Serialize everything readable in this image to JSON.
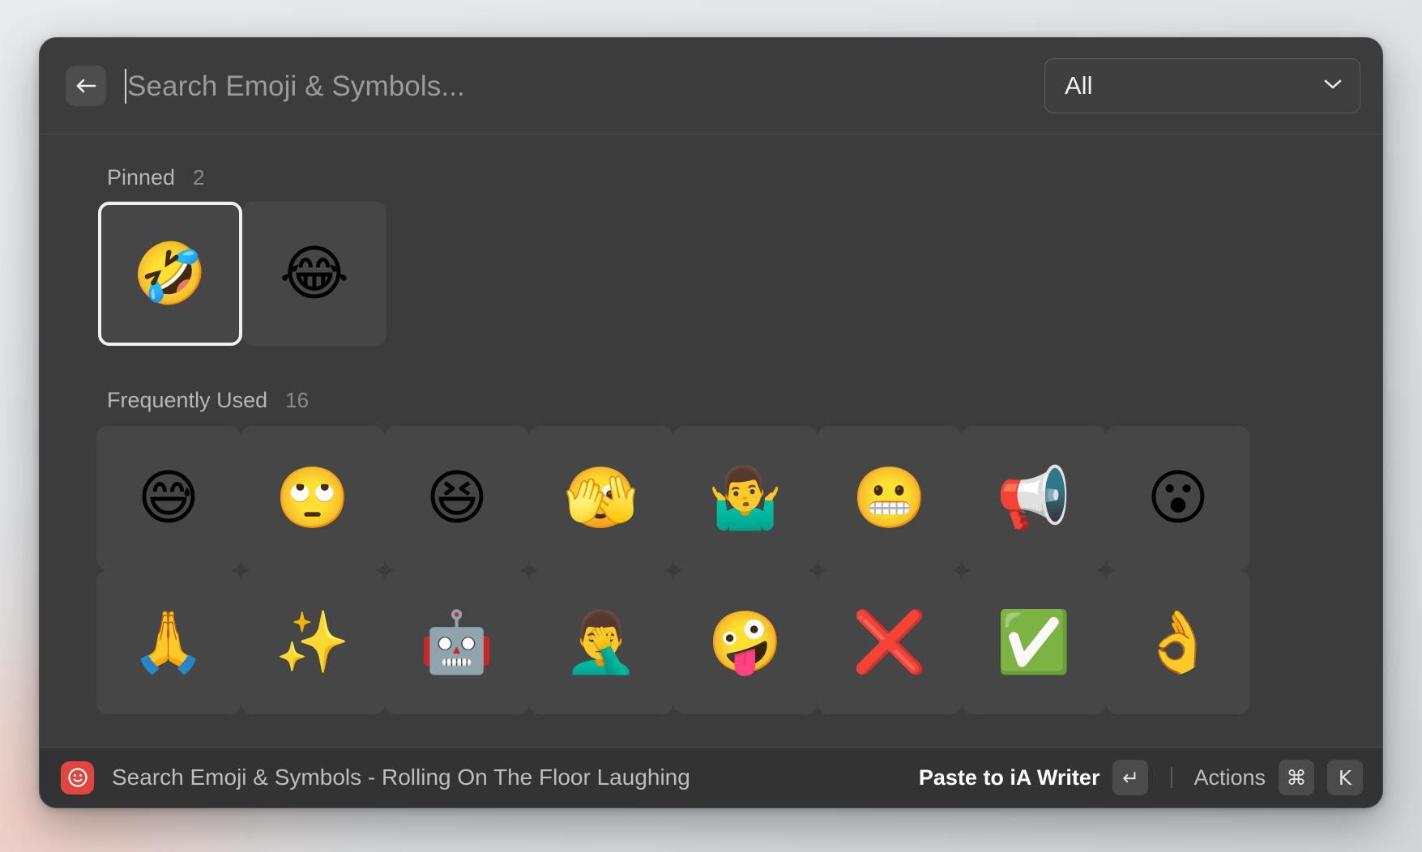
{
  "window": {
    "title_bar_visible": false
  },
  "search": {
    "placeholder": "Search Emoji & Symbols...",
    "value": "",
    "back_icon": "back-arrow-icon"
  },
  "category_filter": {
    "selected": "All",
    "chevron_icon": "chevron-down-icon"
  },
  "sections": [
    {
      "id": "pinned",
      "title": "Pinned",
      "count": "2",
      "items": [
        {
          "glyph": "🤣",
          "name": "rolling-on-the-floor-laughing",
          "selected": true
        },
        {
          "glyph": "😂",
          "name": "face-with-tears-of-joy",
          "selected": false
        }
      ]
    },
    {
      "id": "frequently-used",
      "title": "Frequently Used",
      "count": "16",
      "items": [
        {
          "glyph": "😅",
          "name": "grinning-face-with-sweat",
          "selected": false
        },
        {
          "glyph": "🙄",
          "name": "face-with-rolling-eyes",
          "selected": false
        },
        {
          "glyph": "😆",
          "name": "grinning-squinting-face",
          "selected": false
        },
        {
          "glyph": "🫣",
          "name": "face-with-peeking-eye",
          "selected": false
        },
        {
          "glyph": "🤷‍♂️",
          "name": "man-shrugging",
          "selected": false
        },
        {
          "glyph": "😬",
          "name": "grimacing-face",
          "selected": false
        },
        {
          "glyph": "📢",
          "name": "loudspeaker",
          "selected": false
        },
        {
          "glyph": "😮",
          "name": "face-with-open-mouth",
          "selected": false
        },
        {
          "glyph": "🙏",
          "name": "folded-hands",
          "selected": false
        },
        {
          "glyph": "✨",
          "name": "sparkles",
          "selected": false
        },
        {
          "glyph": "🤖",
          "name": "robot",
          "selected": false
        },
        {
          "glyph": "🤦‍♂️",
          "name": "man-facepalming",
          "selected": false
        },
        {
          "glyph": "🤪",
          "name": "zany-face",
          "selected": false
        },
        {
          "glyph": "❌",
          "name": "cross-mark",
          "selected": false
        },
        {
          "glyph": "✅",
          "name": "check-mark-button",
          "selected": false
        },
        {
          "glyph": "👌",
          "name": "ok-hand",
          "selected": false
        }
      ]
    }
  ],
  "footer": {
    "app_icon": "emoji-smiley-app-icon",
    "status_text": "Search Emoji & Symbols - Rolling On The Floor Laughing",
    "primary_action": "Paste to iA Writer",
    "primary_action_key": "↵",
    "secondary_action": "Actions",
    "secondary_action_keys": [
      "⌘",
      "K"
    ]
  },
  "colors": {
    "window_background": "#3c3c3c",
    "footer_background": "#333333",
    "tile_background": "#464646",
    "selection_border": "#f0f0f0",
    "app_icon_red": "#e0453f",
    "text_primary": "#f2f2f2",
    "text_secondary": "#b6b6b6",
    "text_muted": "#8a8a8a"
  }
}
